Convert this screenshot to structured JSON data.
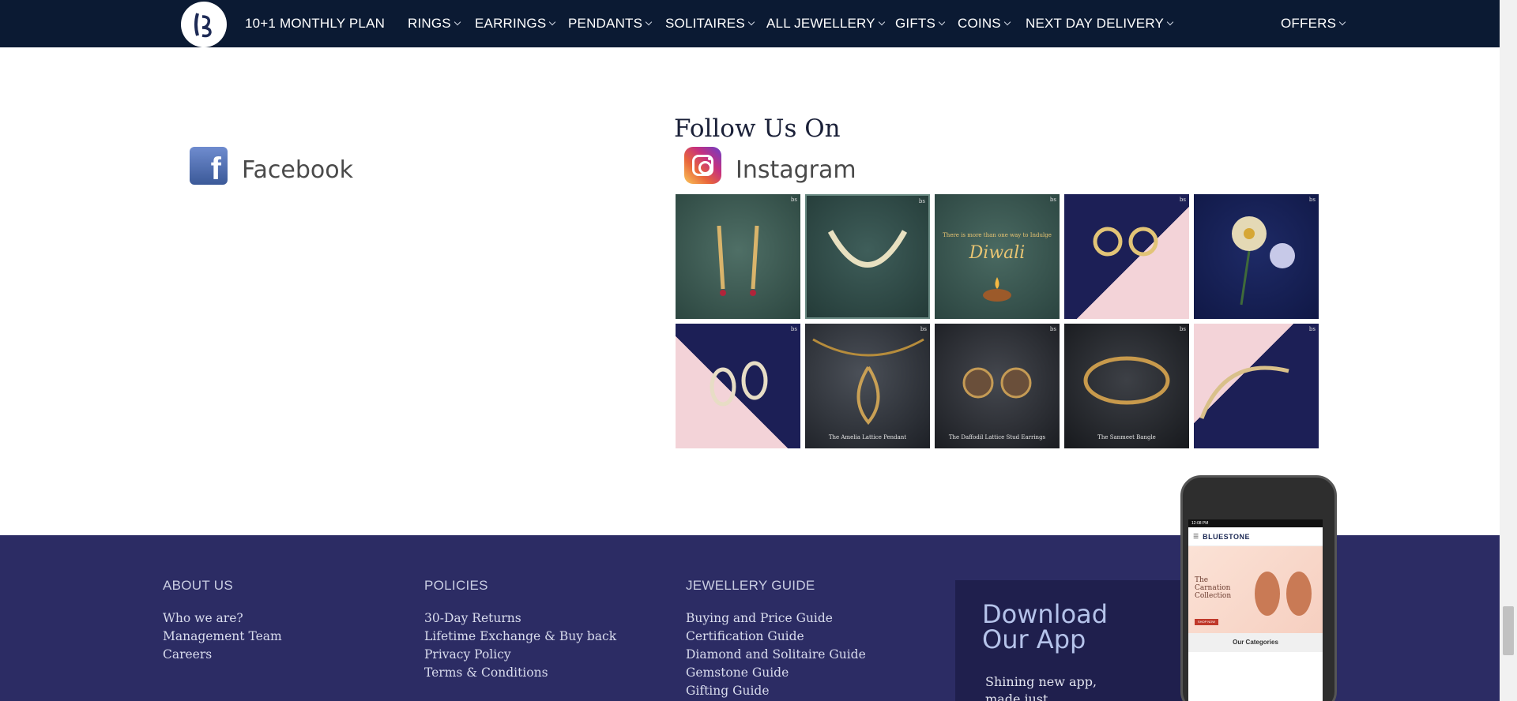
{
  "nav": {
    "items": [
      {
        "label": "10+1 MONTHLY PLAN",
        "has_dropdown": false
      },
      {
        "label": "RINGS",
        "has_dropdown": true
      },
      {
        "label": "EARRINGS",
        "has_dropdown": true
      },
      {
        "label": "PENDANTS",
        "has_dropdown": true
      },
      {
        "label": "SOLITAIRES",
        "has_dropdown": true
      },
      {
        "label": "ALL JEWELLERY",
        "has_dropdown": true
      },
      {
        "label": "GIFTS",
        "has_dropdown": true
      },
      {
        "label": "COINS",
        "has_dropdown": true
      },
      {
        "label": "NEXT DAY DELIVERY",
        "has_dropdown": true
      },
      {
        "label": "OFFERS",
        "has_dropdown": true
      }
    ],
    "background": "#0b1a33"
  },
  "social": {
    "follow_title": "Follow Us On",
    "facebook_label": "Facebook",
    "instagram_label": "Instagram",
    "posts": [
      {
        "icon": "earrings-image",
        "caption": ""
      },
      {
        "icon": "necklace-image",
        "caption": ""
      },
      {
        "icon": "diwali-image",
        "caption": "",
        "title": "Diwali",
        "subtitle": "There is more than one way to Indulge"
      },
      {
        "icon": "earrings-image",
        "caption": ""
      },
      {
        "icon": "flower-brooch-image",
        "caption": ""
      },
      {
        "icon": "earrings-image",
        "caption": ""
      },
      {
        "icon": "pendant-image",
        "caption": "The Amelia Lattice Pendant"
      },
      {
        "icon": "stud-earrings-image",
        "caption": "The Daffodil Lattice Stud Earrings"
      },
      {
        "icon": "bangle-image",
        "caption": "The Sanmeet Bangle"
      },
      {
        "icon": "bracelet-image",
        "caption": ""
      }
    ]
  },
  "footer": {
    "background": "#2c2c64",
    "columns": [
      {
        "heading": "ABOUT US",
        "links": [
          "Who we are?",
          "Management Team",
          "Careers"
        ]
      },
      {
        "heading": "POLICIES",
        "links": [
          "30-Day Returns",
          "Lifetime Exchange & Buy back",
          "Privacy Policy",
          "Terms & Conditions"
        ]
      },
      {
        "heading": "JEWELLERY GUIDE",
        "links": [
          "Buying and Price Guide",
          "Certification Guide",
          "Diamond and Solitaire Guide",
          "Gemstone Guide",
          "Gifting Guide"
        ]
      }
    ],
    "app": {
      "title": "Download Our App",
      "subtitle": "Shining new app, made just"
    }
  },
  "phone": {
    "status_time": "12:08 PM",
    "brand": "BLUESTONE",
    "banner_title": "The Carnation Collection",
    "banner_button": "SHOP NOW",
    "categories_label": "Our Categories"
  }
}
